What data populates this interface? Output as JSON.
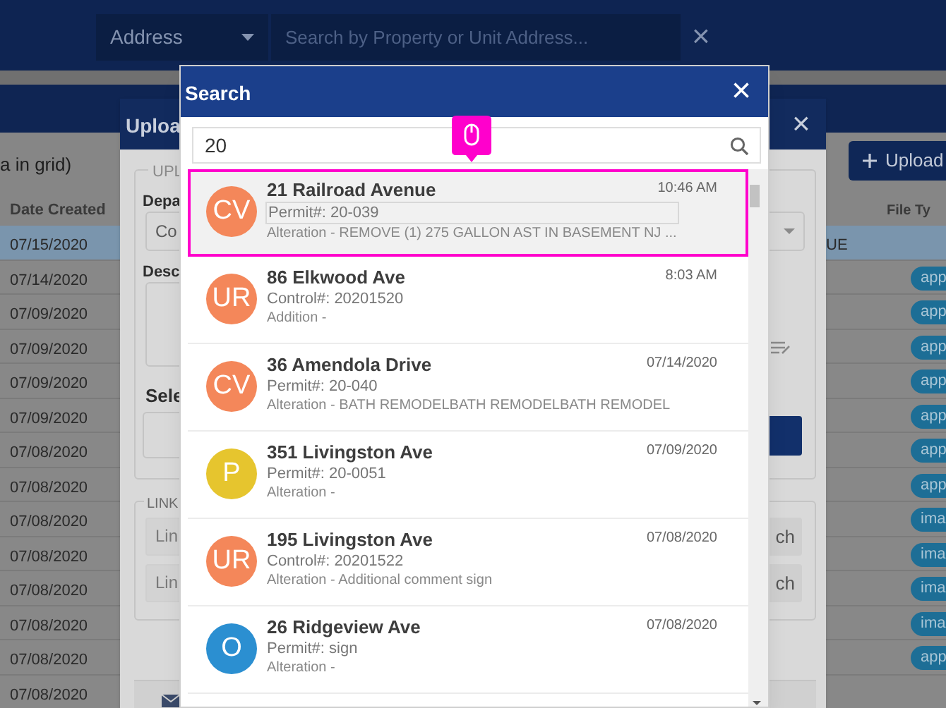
{
  "top_bar": {
    "filter_dropdown": "Address",
    "search": {
      "placeholder": "Search by Property or Unit Address..."
    },
    "clear": "×"
  },
  "grid": {
    "toolbar_text": "a in grid)",
    "upload_button": "Upload",
    "columns": [
      "Date Created",
      "File Ty"
    ],
    "rows": [
      {
        "date": "07/15/2020",
        "column_2": "UE",
        "selected": true
      },
      {
        "date": "07/14/2020",
        "file_type": "app",
        "selected": false
      },
      {
        "date": "07/09/2020",
        "file_type": "app",
        "selected": false
      },
      {
        "date": "07/09/2020",
        "file_type": "app",
        "selected": false
      },
      {
        "date": "07/09/2020",
        "file_type": "app",
        "selected": false
      },
      {
        "date": "07/09/2020",
        "file_type": "app",
        "selected": false
      },
      {
        "date": "07/08/2020",
        "file_type": "app",
        "selected": false
      },
      {
        "date": "07/08/2020",
        "file_type": "app",
        "selected": false
      },
      {
        "date": "07/08/2020",
        "file_type": "ima",
        "selected": false
      },
      {
        "date": "07/08/2020",
        "file_type": "ima",
        "selected": false
      },
      {
        "date": "07/08/2020",
        "file_type": "ima",
        "selected": false
      },
      {
        "date": "07/08/2020",
        "file_type": "ima",
        "selected": false
      },
      {
        "date": "07/08/2020",
        "file_type": "app",
        "selected": false
      },
      {
        "date": "07/08/2020",
        "selected": false
      }
    ]
  },
  "upload_dialog": {
    "title": "Uploa",
    "close": "×",
    "upload_legend": "UPL",
    "department_label": "Depa",
    "department_value": "Co",
    "description_label": "Desc",
    "select_label": "Sele",
    "link_legend": "LINK",
    "link_fields": [
      {
        "value": "Lin",
        "button": "ch"
      },
      {
        "value": "Lin",
        "button": "ch"
      }
    ]
  },
  "search_dialog": {
    "title": "Search",
    "close": "×",
    "query": "20",
    "results": [
      {
        "initials": "CV",
        "color": "#f4875a",
        "address": "21 Railroad Avenue",
        "time": "10:46 AM",
        "number": "Permit#: 20-039",
        "description": "Alteration - REMOVE (1) 275 GALLON AST IN BASEMENT NJ ...",
        "selected": true
      },
      {
        "initials": "UR",
        "color": "#f4875a",
        "address": "86 Elkwood Ave",
        "time": "8:03 AM",
        "number": "Control#: 20201520",
        "description": "Addition -",
        "selected": false
      },
      {
        "initials": "CV",
        "color": "#f4875a",
        "address": "36 Amendola Drive",
        "time": "07/14/2020",
        "number": "Permit#: 20-040",
        "description": "Alteration - BATH REMODELBATH REMODELBATH REMODEL",
        "selected": false
      },
      {
        "initials": "P",
        "color": "#e6c52e",
        "address": "351 Livingston Ave",
        "time": "07/09/2020",
        "number": "Permit#: 20-0051",
        "description": "Alteration -",
        "selected": false
      },
      {
        "initials": "UR",
        "color": "#f4875a",
        "address": "195 Livingston Ave",
        "time": "07/08/2020",
        "number": "Control#: 20201522",
        "description": "Alteration - Additional comment sign",
        "selected": false
      },
      {
        "initials": "O",
        "color": "#2b8fd1",
        "address": "26 Ridgeview Ave",
        "time": "07/08/2020",
        "number": "Permit#: sign",
        "description": "Alteration -",
        "selected": false
      }
    ]
  }
}
